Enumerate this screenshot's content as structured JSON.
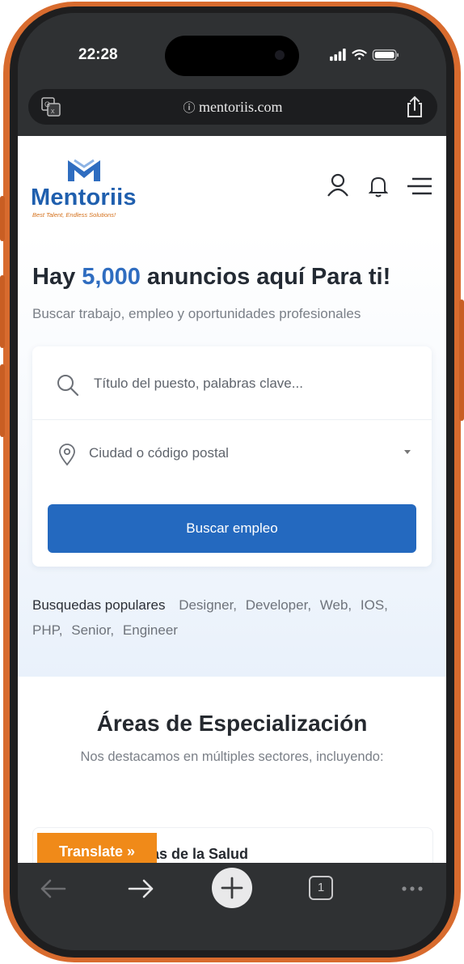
{
  "status_bar": {
    "time": "22:28"
  },
  "browser": {
    "url": "mentoriis.com"
  },
  "site": {
    "brand": "Mentoriis",
    "tagline": "Best Talent, Endless Solutions!"
  },
  "hero": {
    "title_prefix": "Hay ",
    "title_count": "5,000",
    "title_suffix": " anuncios aquí Para ti!",
    "subtitle": "Buscar trabajo, empleo y oportunidades profesionales",
    "keyword_placeholder": "Título del puesto, palabras clave...",
    "location_value": "Ciudad o código postal",
    "search_button": "Buscar empleo",
    "popular_label": "Busquedas populares",
    "popular_tags": [
      "Designer,",
      "Developer,",
      "Web,",
      "IOS,",
      "PHP,",
      "Senior,",
      "Engineer"
    ]
  },
  "areas": {
    "title": "Áreas de Especialización",
    "subtitle": "Nos destacamos en múltiples sectores, incluyendo:",
    "first_card_label_visible": "as de la Salud"
  },
  "translate_widget": {
    "label": "Translate »"
  },
  "toolbar": {
    "tab_count": "1"
  },
  "colors": {
    "accent": "#2469bf",
    "brand_orange": "#f08a19",
    "phone_frame": "#d86b2e"
  }
}
